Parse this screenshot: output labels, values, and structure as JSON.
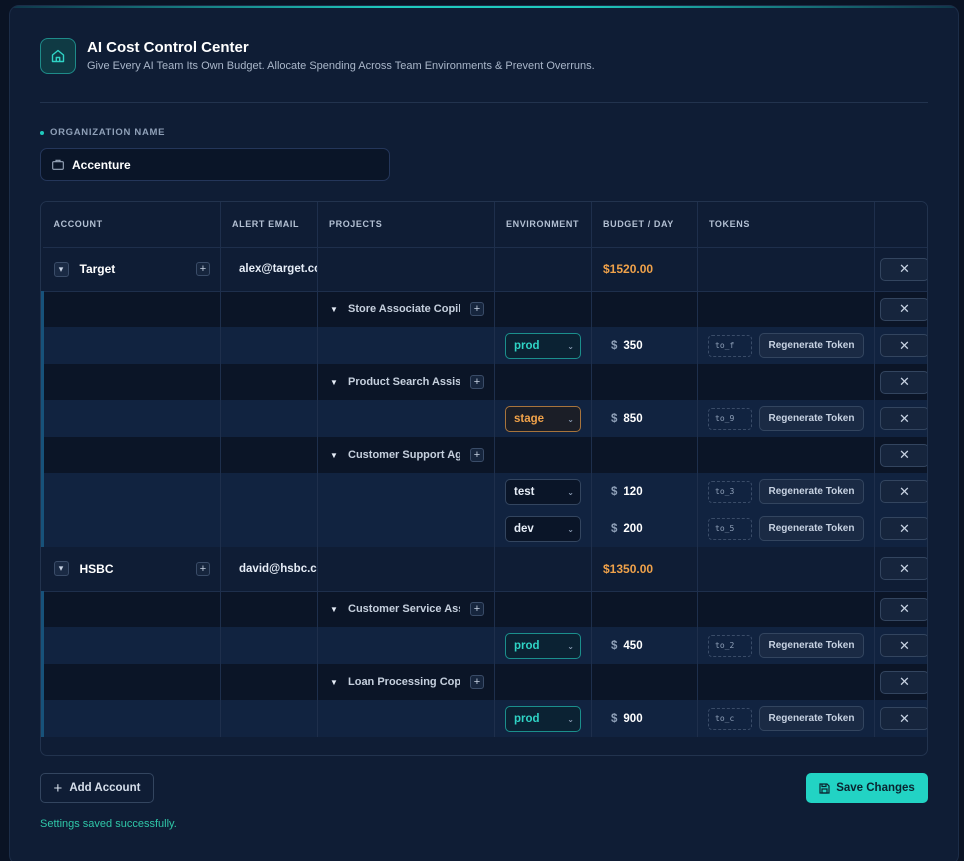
{
  "header": {
    "title": "AI Cost Control Center",
    "subtitle": "Give Every AI Team Its Own Budget. Allocate Spending Across Team Environments & Prevent Overruns.",
    "icon": "home-icon"
  },
  "org": {
    "label": "ORGANIZATION NAME",
    "value": "Accenture"
  },
  "table": {
    "columns": [
      "ACCOUNT",
      "ALERT EMAIL",
      "PROJECTS",
      "ENVIRONMENT",
      "BUDGET / DAY",
      "TOKENS",
      ""
    ],
    "accounts": [
      {
        "name": "Target",
        "email": "alex@target.com",
        "budget": "$1520.00",
        "projects": [
          {
            "name": "Store Associate Copilot",
            "envs": [
              {
                "env": "prod",
                "amount": "350",
                "token": "to_f"
              }
            ]
          },
          {
            "name": "Product Search Assistant",
            "envs": [
              {
                "env": "stage",
                "amount": "850",
                "token": "to_9"
              }
            ]
          },
          {
            "name": "Customer Support Agent",
            "envs": [
              {
                "env": "test",
                "amount": "120",
                "token": "to_3"
              },
              {
                "env": "dev",
                "amount": "200",
                "token": "to_5"
              }
            ]
          }
        ]
      },
      {
        "name": "HSBC",
        "email": "david@hsbc.com",
        "budget": "$1350.00",
        "projects": [
          {
            "name": "Customer Service Assistant",
            "envs": [
              {
                "env": "prod",
                "amount": "450",
                "token": "to_2"
              }
            ]
          },
          {
            "name": "Loan Processing Copilot",
            "envs": [
              {
                "env": "prod",
                "amount": "900",
                "token": "to_c"
              }
            ]
          }
        ]
      }
    ],
    "dollar_sign": "$",
    "regenerate_label": "Regenerate Token",
    "delete_glyph": "✕"
  },
  "footer": {
    "add_label": "Add Account",
    "save_label": "Save Changes",
    "status": "Settings saved successfully."
  },
  "colors": {
    "accent": "#22d3c4",
    "budget": "#f0a24a",
    "background": "#0a1324",
    "card": "#0f1d35"
  }
}
